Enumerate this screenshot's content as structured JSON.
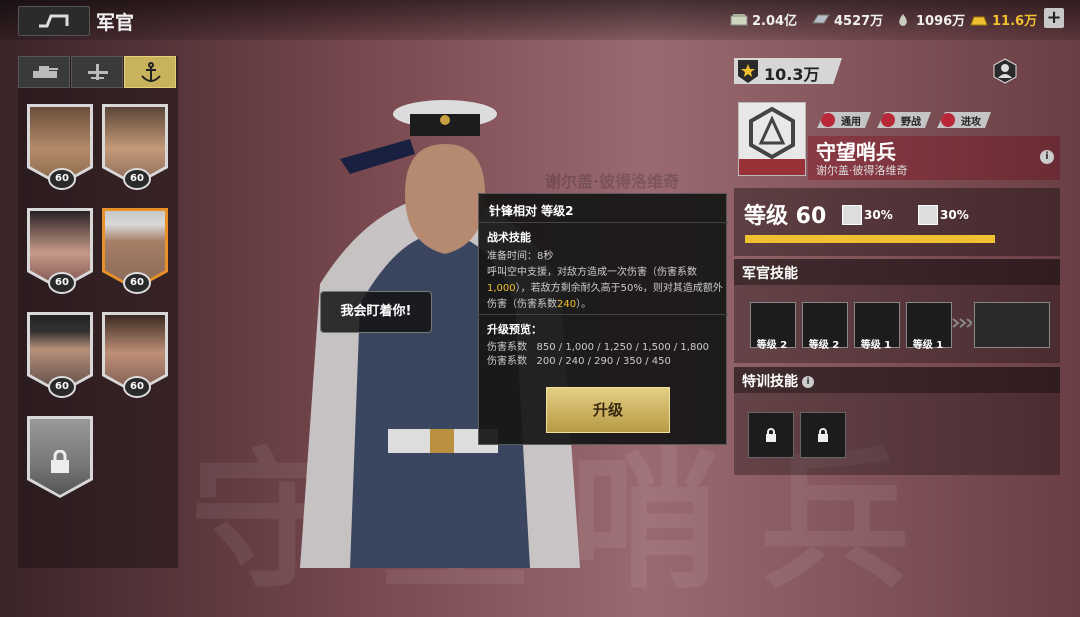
{
  "header": {
    "title": "军官",
    "resources": [
      {
        "name": "banknote-icon",
        "value": "2.04亿"
      },
      {
        "name": "steel-icon",
        "value": "4527万"
      },
      {
        "name": "oil-icon",
        "value": "1096万"
      },
      {
        "name": "gold-icon",
        "value": "11.6万"
      }
    ],
    "plus": "+"
  },
  "left_tabs": [
    {
      "name": "tank-icon",
      "active": false
    },
    {
      "name": "plane-icon",
      "active": false
    },
    {
      "name": "anchor-icon",
      "active": true
    }
  ],
  "officers": [
    {
      "level": "60",
      "selected": false,
      "locked": false
    },
    {
      "level": "60",
      "selected": false,
      "locked": false
    },
    {
      "level": "60",
      "selected": false,
      "locked": false
    },
    {
      "level": "60",
      "selected": true,
      "locked": false
    },
    {
      "level": "60",
      "selected": false,
      "locked": false
    },
    {
      "level": "60",
      "selected": false,
      "locked": false
    },
    {
      "level": "",
      "selected": false,
      "locked": true
    }
  ],
  "speech": "我会盯着你!",
  "watermark": "守望哨兵",
  "watermark_small": "谢尔盖·彼得洛维奇",
  "tooltip": {
    "title": "针锋相对 等级2",
    "tactic_header": "战术技能",
    "prep": "准备时间：8秒",
    "desc_1": "呼叫空中支援，对敌方造成一次伤害（伤害系数",
    "desc_val1": "1,000",
    "desc_2": "），若敌方剩余耐久高于50%，则对其造成额外伤害（伤害系数",
    "desc_val2": "240",
    "desc_3": "）。",
    "preview_header": "升级预览：",
    "row1": "伤害系数   850 / 1,000 / 1,250 / 1,500 / 1,800",
    "row2": "伤害系数   200 / 240 / 290 / 350 / 450",
    "upgrade_button": "升级"
  },
  "right": {
    "power": "10.3万",
    "tags": [
      "通用",
      "野战",
      "进攻"
    ],
    "name": "守望哨兵",
    "subname": "谢尔盖·彼得洛维奇",
    "level_label": "等级 60",
    "stat1": "30%",
    "stat2": "30%",
    "progress": 1.0,
    "skills_header": "军官技能",
    "skills": [
      {
        "label": "等级 2",
        "icon": "jet-skill-icon"
      },
      {
        "label": "等级 2",
        "icon": "officer-cap-skill-icon"
      },
      {
        "label": "等级 1",
        "icon": "bomb-skill-icon"
      },
      {
        "label": "等级 1",
        "icon": "anchor-skill-icon"
      }
    ],
    "special_header": "特训技能"
  },
  "colors": {
    "accent": "#f1c030",
    "brand_red": "#b82838"
  }
}
